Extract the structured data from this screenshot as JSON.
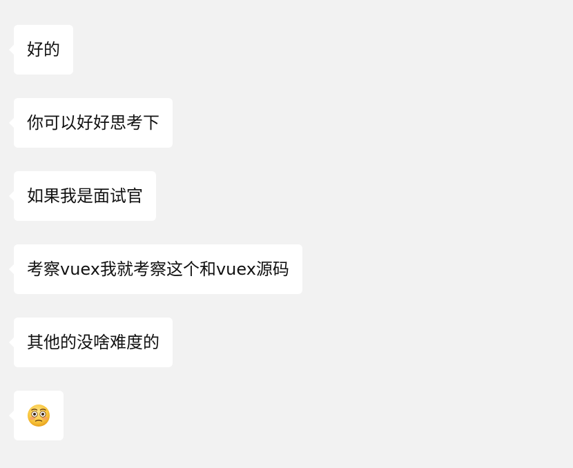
{
  "conversation": {
    "messages": [
      {
        "text": "好的"
      },
      {
        "text": "你可以好好思考下"
      },
      {
        "text": "如果我是面试官"
      },
      {
        "text": "考察vuex我就考察这个和vuex源码"
      },
      {
        "text": "其他的没啥难度的"
      },
      {
        "emoji": "flushed-face-emoji"
      }
    ]
  },
  "colors": {
    "background": "#f2f2f2",
    "bubble": "#ffffff",
    "text": "#111111"
  }
}
